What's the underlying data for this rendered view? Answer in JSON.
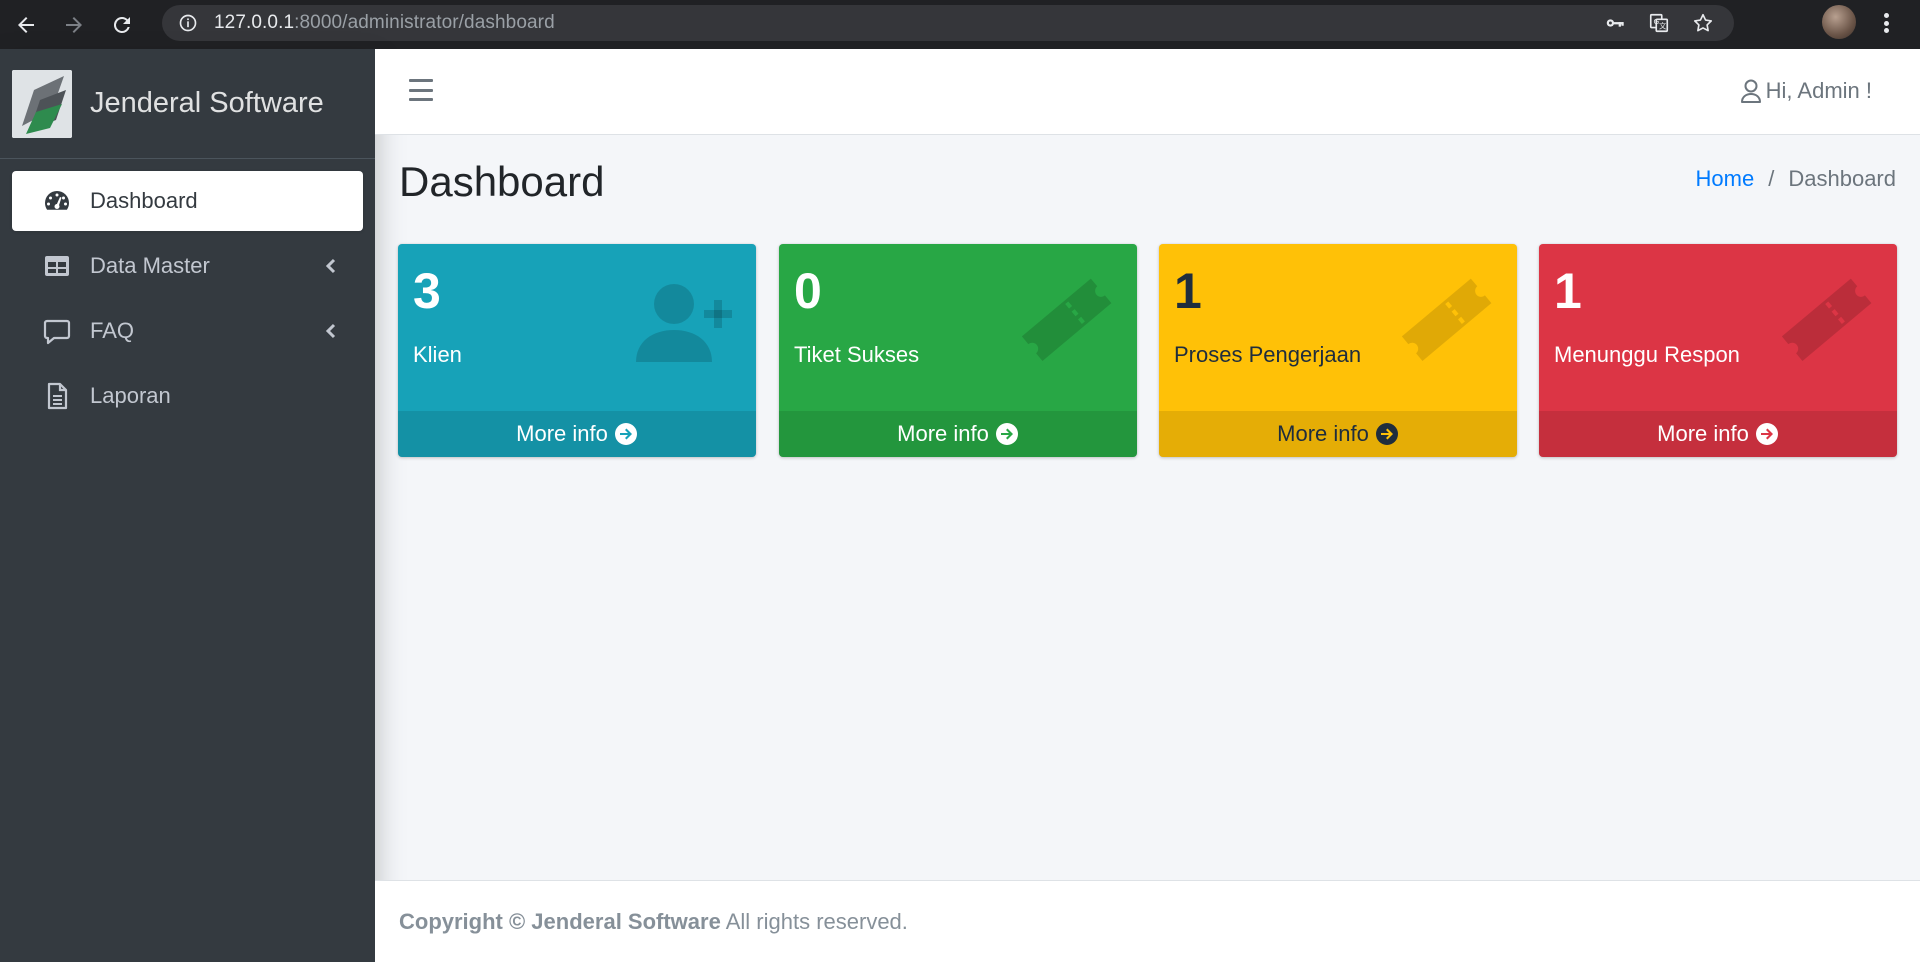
{
  "browser": {
    "url_host": "127.0.0.1",
    "url_rest": ":8000/administrator/dashboard"
  },
  "sidebar": {
    "brand": "Jenderal Software",
    "items": [
      {
        "label": "Dashboard",
        "icon": "tachometer-icon",
        "active": true
      },
      {
        "label": "Data Master",
        "icon": "table-icon",
        "has_submenu": true
      },
      {
        "label": "FAQ",
        "icon": "comment-icon",
        "has_submenu": true
      },
      {
        "label": "Laporan",
        "icon": "file-icon"
      }
    ]
  },
  "topbar": {
    "greeting": "Hi, Admin !"
  },
  "header": {
    "title": "Dashboard",
    "breadcrumb": {
      "home": "Home",
      "separator": "/",
      "current": "Dashboard"
    }
  },
  "boxes": [
    {
      "value": "3",
      "label": "Klien",
      "more": "More info",
      "color": "#17a2b8",
      "icon": "user-plus-icon"
    },
    {
      "value": "0",
      "label": "Tiket Sukses",
      "more": "More info",
      "color": "#28a745",
      "icon": "ticket-icon"
    },
    {
      "value": "1",
      "label": "Proses Pengerjaan",
      "more": "More info",
      "color": "#ffc107",
      "icon": "ticket-icon"
    },
    {
      "value": "1",
      "label": "Menunggu Respon",
      "more": "More info",
      "color": "#dc3545",
      "icon": "ticket-icon"
    }
  ],
  "footer": {
    "copyright": "Copyright © Jenderal Software",
    "rights": " All rights reserved."
  }
}
